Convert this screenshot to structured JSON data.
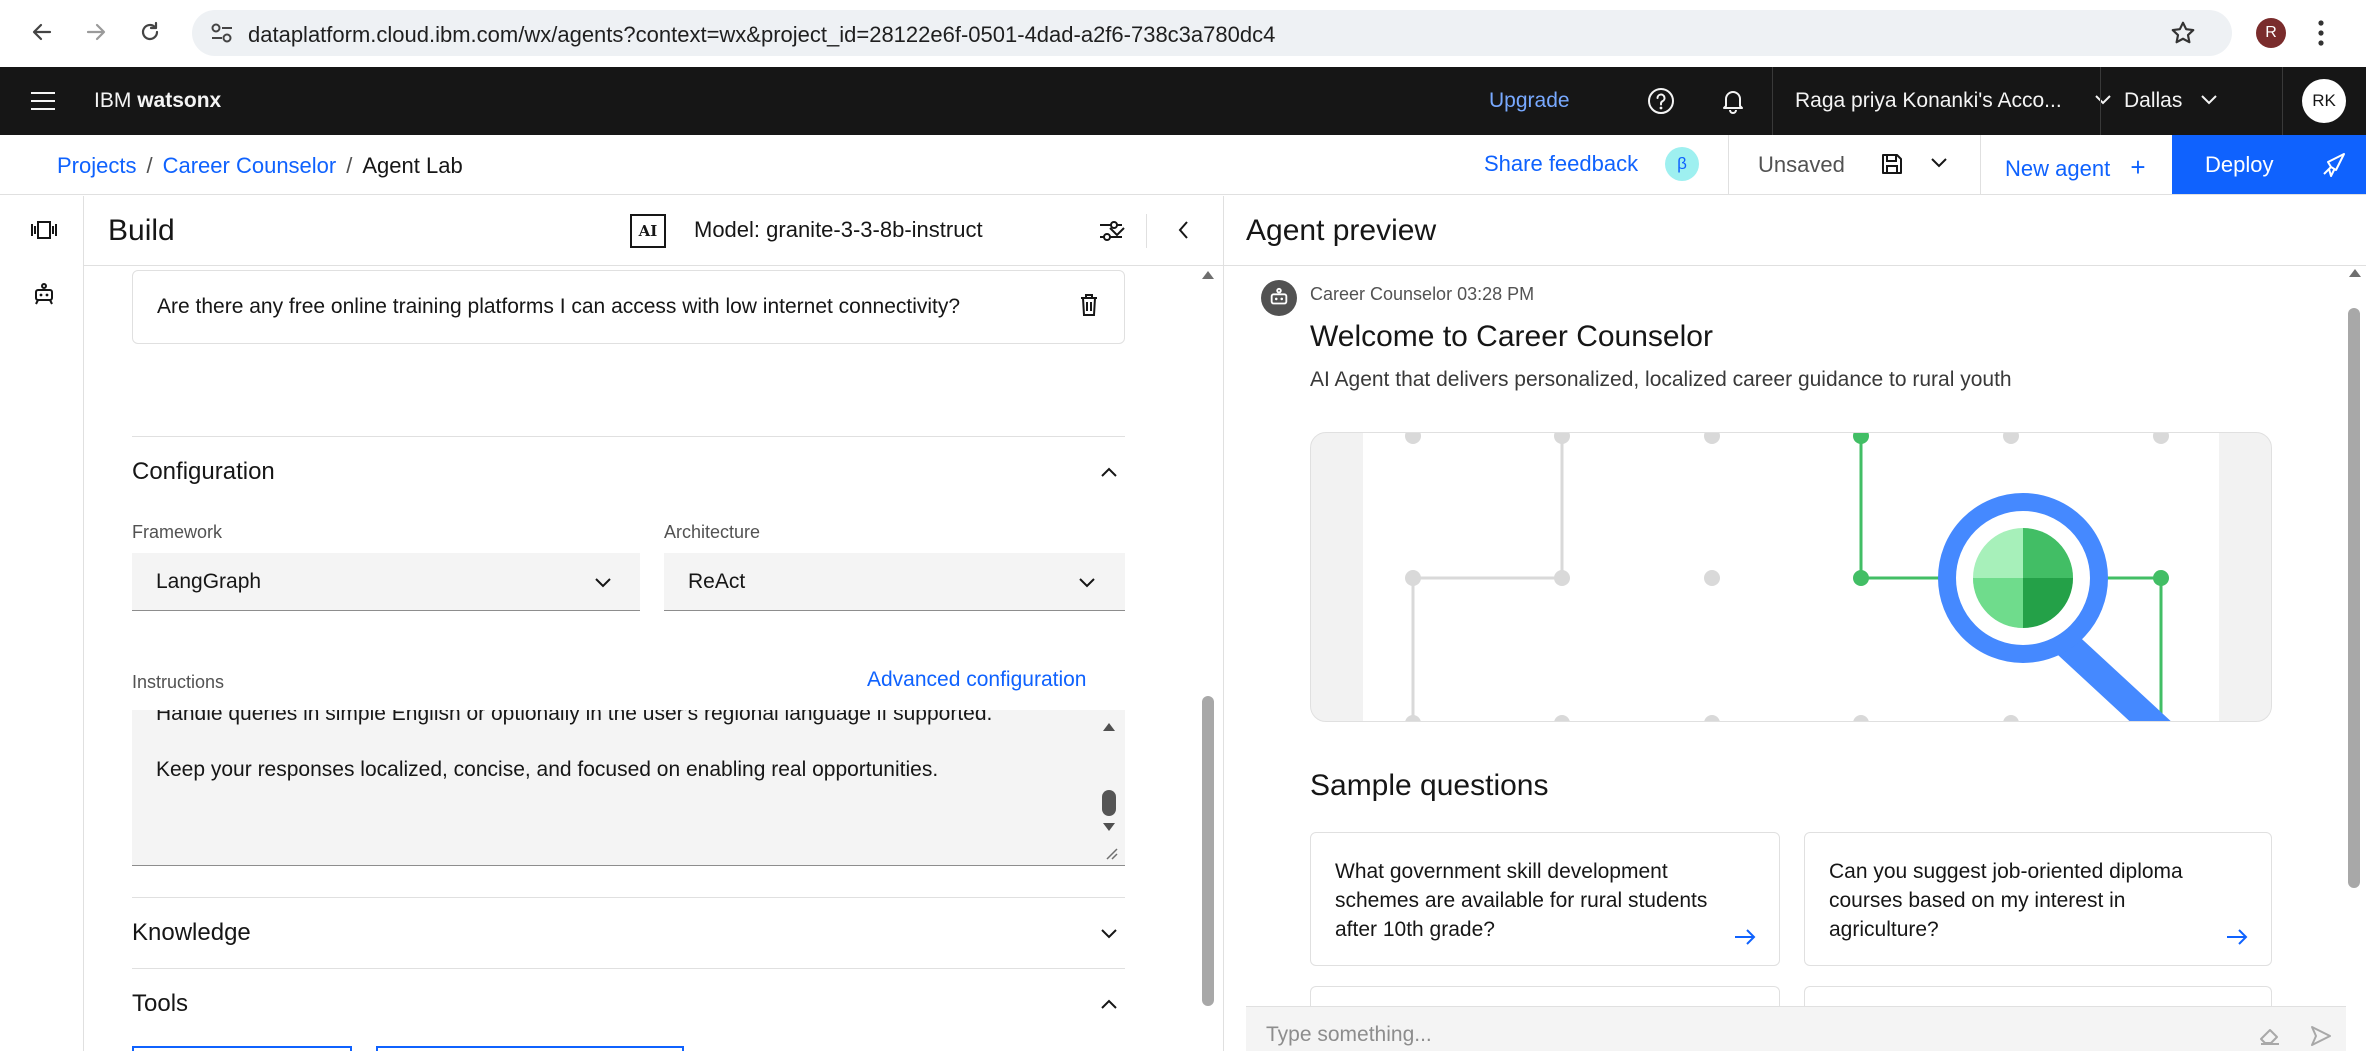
{
  "browser": {
    "url": "dataplatform.cloud.ibm.com/wx/agents?context=wx&project_id=28122e6f-0501-4dad-a2f6-738c3a780dc4",
    "profile_initial": "R"
  },
  "header": {
    "brand_prefix": "IBM",
    "brand_product": "watsonx",
    "upgrade_label": "Upgrade",
    "account_name": "Raga priya Konanki's Acco...",
    "region": "Dallas",
    "user_initials": "RK"
  },
  "breadcrumb": {
    "items": [
      "Projects",
      "Career Counselor",
      "Agent Lab"
    ],
    "separator": "/"
  },
  "actions": {
    "share_feedback": "Share feedback",
    "beta_badge": "β",
    "save_state": "Unsaved",
    "new_agent": "New agent",
    "new_agent_plus": "+",
    "deploy": "Deploy"
  },
  "build": {
    "title": "Build",
    "ai_badge": "AI",
    "model_label": "Model: granite-3-3-8b-instruct",
    "sample_question": "Are there any free online training platforms I can access with low internet connectivity?",
    "configuration": {
      "title": "Configuration",
      "framework_label": "Framework",
      "framework_value": "LangGraph",
      "architecture_label": "Architecture",
      "architecture_value": "ReAct"
    },
    "instructions": {
      "label": "Instructions",
      "advanced_link": "Advanced configuration",
      "line1": "Handle queries in simple English or optionally in the user's regional language if supported.",
      "line2": "Keep your responses localized, concise, and focused on enabling real opportunities."
    },
    "knowledge_title": "Knowledge",
    "tools_title": "Tools"
  },
  "preview": {
    "title": "Agent preview",
    "agent_name": "Career Counselor",
    "time": "03:28 PM",
    "welcome_title": "Welcome to Career Counselor",
    "welcome_subtitle": "AI Agent that delivers personalized, localized career guidance to rural youth",
    "sample_title": "Sample questions",
    "samples": [
      "What government skill development schemes are available for rural students after 10th grade?",
      "Can you suggest job-oriented diploma courses based on my interest in agriculture?"
    ],
    "input_placeholder": "Type something..."
  },
  "colors": {
    "ibm_blue": "#0f62fe",
    "header_bg": "#161616",
    "hero_green": "#42be65",
    "hero_blue": "#4589ff"
  }
}
